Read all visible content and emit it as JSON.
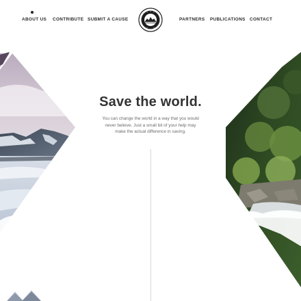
{
  "nav": {
    "left": [
      {
        "label": "ABOUT US",
        "active": true
      },
      {
        "label": "CONTRIBUTE",
        "active": false
      },
      {
        "label": "SUBMIT A CAUSE",
        "active": false
      }
    ],
    "right": [
      {
        "label": "PARTNERS",
        "active": false
      },
      {
        "label": "PUBLICATIONS",
        "active": false
      },
      {
        "label": "CONTACT",
        "active": false
      }
    ]
  },
  "hero": {
    "title": "Save the world.",
    "body": "You can change the world in a way that you would never believe. Just a small bit of your help may make the actual difference in saving."
  },
  "colors": {
    "text_dark": "#333333",
    "text_muted": "#6b6b6b",
    "logo_fill": "#1f1f1f",
    "divider": "#d9d9d9"
  }
}
